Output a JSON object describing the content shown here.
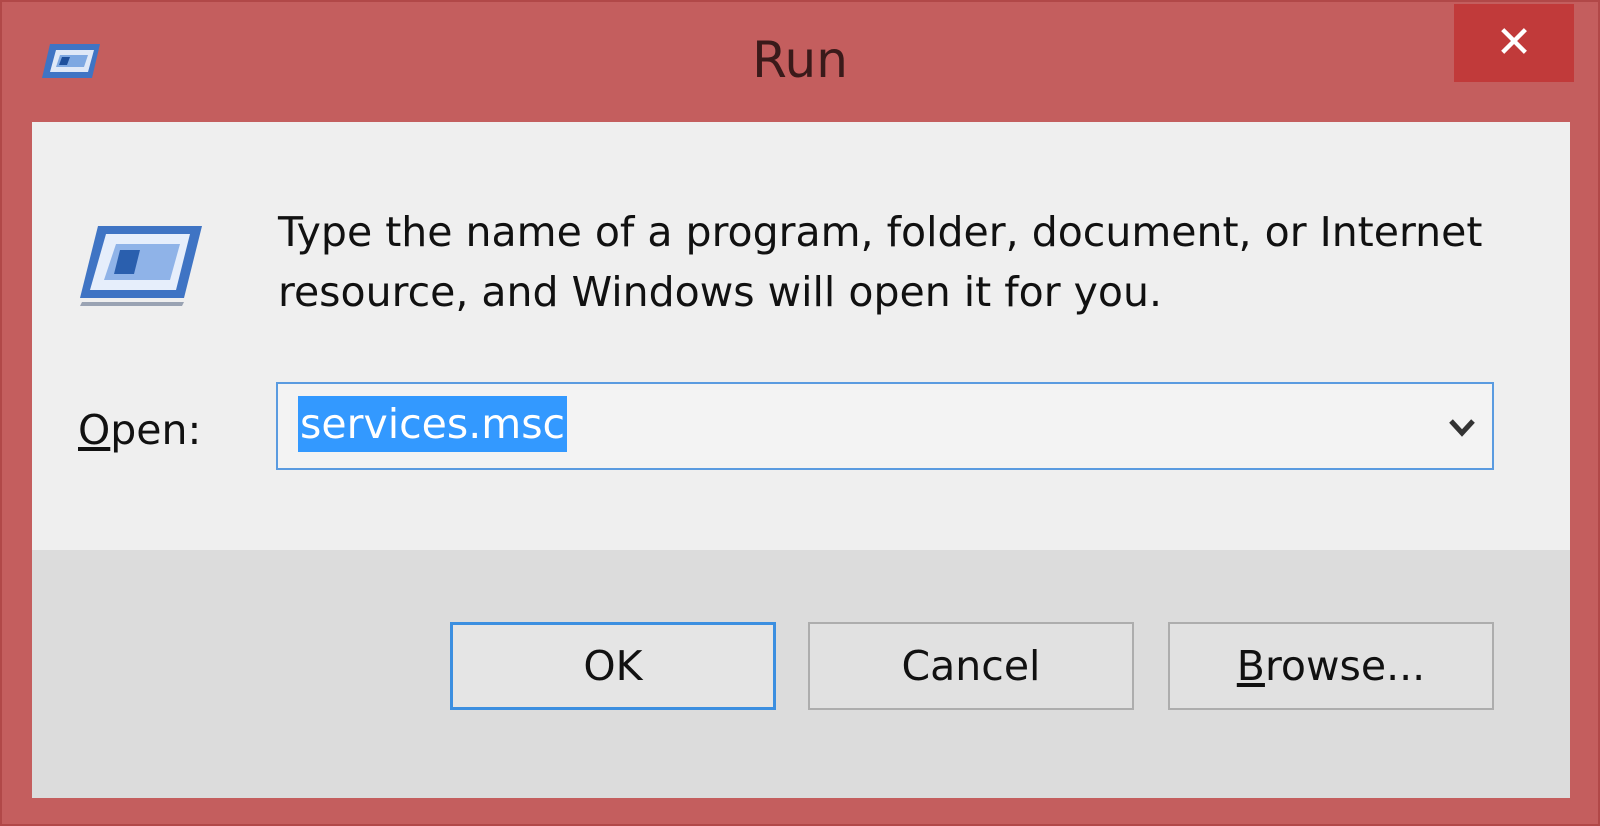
{
  "window": {
    "title": "Run",
    "close_symbol": "✕",
    "title_icon": "run-icon"
  },
  "dialog": {
    "description": "Type the name of a program, folder, document, or Internet resource, and Windows will open it for you.",
    "open_label_accel": "O",
    "open_label_rest": "pen:",
    "open_value": "services.msc",
    "dropdown_icon": "chevron-down-icon"
  },
  "buttons": {
    "ok_label": "OK",
    "cancel_label": "Cancel",
    "browse_accel": "B",
    "browse_rest": "rowse..."
  },
  "colors": {
    "frame": "#c45e5e",
    "close_button": "#c13a3a",
    "selection": "#3399ff",
    "focus_border": "#3c8fe0"
  }
}
